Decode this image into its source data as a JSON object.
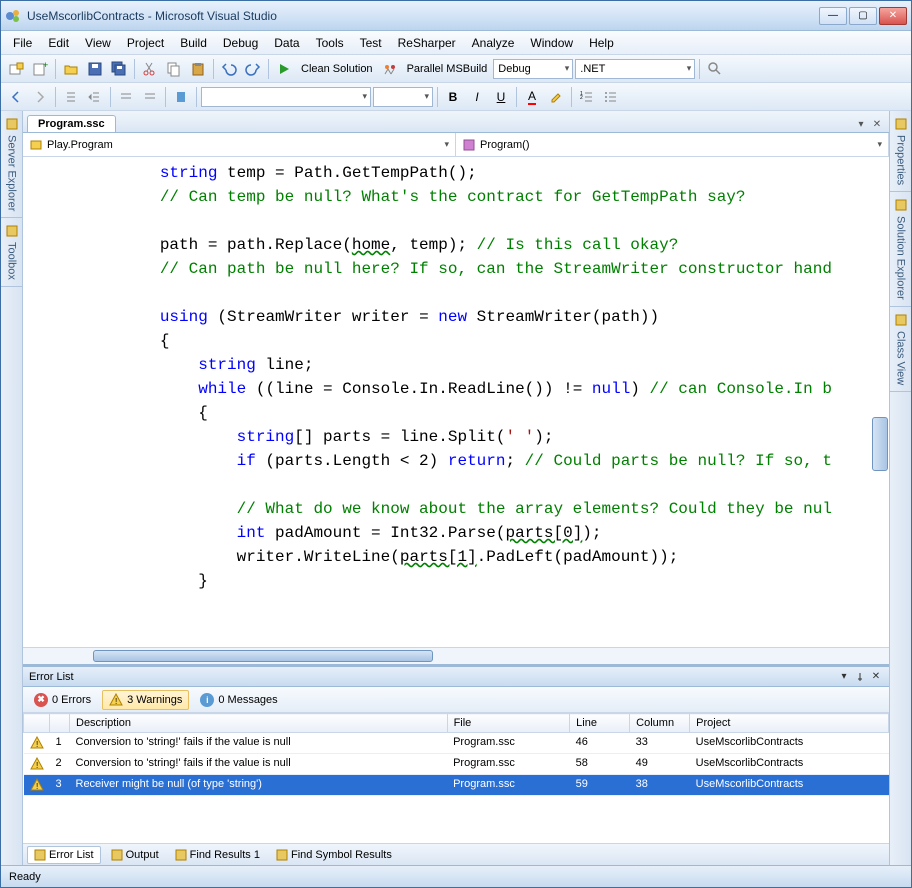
{
  "window": {
    "title": "UseMscorlibContracts - Microsoft Visual Studio"
  },
  "menu": [
    "File",
    "Edit",
    "View",
    "Project",
    "Build",
    "Debug",
    "Data",
    "Tools",
    "Test",
    "ReSharper",
    "Analyze",
    "Window",
    "Help"
  ],
  "toolbar": {
    "clean_solution": "Clean Solution",
    "parallel_msbuild": "Parallel MSBuild",
    "config": "Debug",
    "platform": ".NET"
  },
  "side_left": [
    "Server Explorer",
    "Toolbox"
  ],
  "side_right": [
    "Properties",
    "Solution Explorer",
    "Class View"
  ],
  "doc_tab": "Program.ssc",
  "nav": {
    "class": "Play.Program",
    "member": "Program()"
  },
  "code_lines": [
    {
      "indent": 4,
      "tokens": [
        {
          "t": "string",
          "c": "kw"
        },
        {
          "t": " temp = Path.GetTempPath();"
        }
      ]
    },
    {
      "indent": 4,
      "tokens": [
        {
          "t": "// Can temp be null? What's the contract for GetTempPath say?",
          "c": "cm"
        }
      ]
    },
    {
      "indent": 0,
      "tokens": []
    },
    {
      "indent": 4,
      "tokens": [
        {
          "t": "path = path.Replace("
        },
        {
          "t": "home",
          "c": "sq"
        },
        {
          "t": ", temp); "
        },
        {
          "t": "// Is this call okay?",
          "c": "cm"
        }
      ]
    },
    {
      "indent": 4,
      "tokens": [
        {
          "t": "// Can path be null here? If so, can the StreamWriter constructor hand",
          "c": "cm"
        }
      ]
    },
    {
      "indent": 0,
      "tokens": []
    },
    {
      "indent": 4,
      "tokens": [
        {
          "t": "using",
          "c": "kw"
        },
        {
          "t": " (StreamWriter writer = "
        },
        {
          "t": "new",
          "c": "kw"
        },
        {
          "t": " StreamWriter(path))"
        }
      ]
    },
    {
      "indent": 4,
      "tokens": [
        {
          "t": "{"
        }
      ]
    },
    {
      "indent": 6,
      "tokens": [
        {
          "t": "string",
          "c": "kw"
        },
        {
          "t": " line;"
        }
      ]
    },
    {
      "indent": 6,
      "tokens": [
        {
          "t": "while",
          "c": "kw"
        },
        {
          "t": " ((line = Console.In.ReadLine()) != "
        },
        {
          "t": "null",
          "c": "kw"
        },
        {
          "t": ") "
        },
        {
          "t": "// can Console.In b",
          "c": "cm"
        }
      ]
    },
    {
      "indent": 6,
      "tokens": [
        {
          "t": "{"
        }
      ]
    },
    {
      "indent": 8,
      "tokens": [
        {
          "t": "string",
          "c": "kw"
        },
        {
          "t": "[] parts = line.Split("
        },
        {
          "t": "' '",
          "c": "str"
        },
        {
          "t": ");"
        }
      ]
    },
    {
      "indent": 8,
      "tokens": [
        {
          "t": "if",
          "c": "kw"
        },
        {
          "t": " (parts.Length < 2) "
        },
        {
          "t": "return",
          "c": "kw"
        },
        {
          "t": "; "
        },
        {
          "t": "// Could parts be null? If so, t",
          "c": "cm"
        }
      ]
    },
    {
      "indent": 0,
      "tokens": []
    },
    {
      "indent": 8,
      "tokens": [
        {
          "t": "// What do we know about the array elements? Could they be nul",
          "c": "cm"
        }
      ]
    },
    {
      "indent": 8,
      "tokens": [
        {
          "t": "int",
          "c": "kw"
        },
        {
          "t": " padAmount = Int32.Parse("
        },
        {
          "t": "parts[0]",
          "c": "sq"
        },
        {
          "t": ");"
        }
      ]
    },
    {
      "indent": 8,
      "tokens": [
        {
          "t": "writer.WriteLine("
        },
        {
          "t": "parts[1]",
          "c": "sq"
        },
        {
          "t": ".PadLeft(padAmount));"
        }
      ]
    },
    {
      "indent": 6,
      "tokens": [
        {
          "t": "}"
        }
      ]
    }
  ],
  "error_list": {
    "title": "Error List",
    "filters": {
      "errors": "0 Errors",
      "warnings": "3 Warnings",
      "messages": "0 Messages"
    },
    "columns": [
      "",
      "",
      "Description",
      "File",
      "Line",
      "Column",
      "Project"
    ],
    "rows": [
      {
        "n": "1",
        "desc": "Conversion to 'string!' fails if the value is null",
        "file": "Program.ssc",
        "line": "46",
        "col": "33",
        "proj": "UseMscorlibContracts",
        "sel": false
      },
      {
        "n": "2",
        "desc": "Conversion to 'string!' fails if the value is null",
        "file": "Program.ssc",
        "line": "58",
        "col": "49",
        "proj": "UseMscorlibContracts",
        "sel": false
      },
      {
        "n": "3",
        "desc": "Receiver might be null (of type 'string')",
        "file": "Program.ssc",
        "line": "59",
        "col": "38",
        "proj": "UseMscorlibContracts",
        "sel": true
      }
    ],
    "tabs": [
      "Error List",
      "Output",
      "Find Results 1",
      "Find Symbol Results"
    ]
  },
  "status": "Ready"
}
